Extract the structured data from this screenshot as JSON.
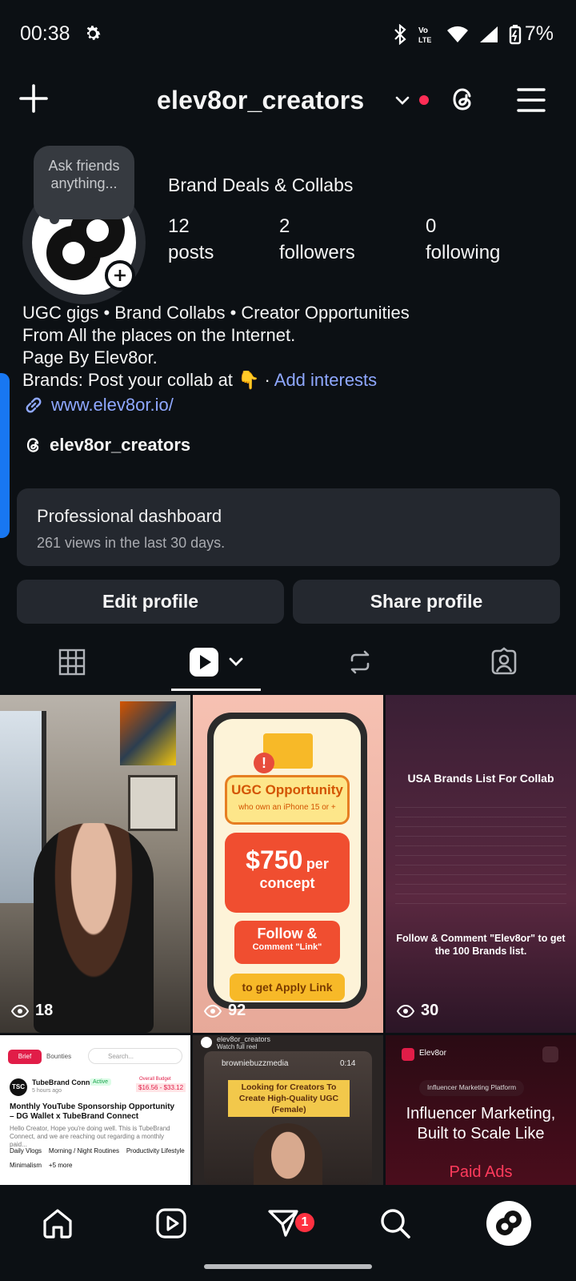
{
  "status": {
    "time": "00:38",
    "battery": "7%"
  },
  "header": {
    "username": "elev8or_creators"
  },
  "profile": {
    "note_bubble": "Ask friends anything...",
    "category": "Brand Deals & Collabs",
    "stats": [
      {
        "value": "12",
        "label": "posts"
      },
      {
        "value": "2",
        "label": "followers"
      },
      {
        "value": "0",
        "label": "following"
      }
    ],
    "bio_lines": [
      "UGC gigs • Brand Collabs • Creator Opportunities",
      "From All the places on the Internet.",
      "Page By Elev8or."
    ],
    "bio_last": "Brands: Post your collab at 👇 · ",
    "add_interests": "Add interests",
    "website": "www.elev8or.io/",
    "threads_handle": "elev8or_creators"
  },
  "dashboard": {
    "title": "Professional dashboard",
    "subtitle": "261 views in the last 30 days."
  },
  "buttons": {
    "edit": "Edit profile",
    "share": "Share profile"
  },
  "posts": [
    {
      "views": "18"
    },
    {
      "views": "92",
      "line1": "UGC Opportunity",
      "line2": "who own an iPhone 15 or +",
      "amount": "$750",
      "per": "per",
      "concept": "concept",
      "follow": "Follow &",
      "comment": "Comment \"Link\"",
      "apply": "to get Apply Link"
    },
    {
      "views": "30",
      "title": "USA Brands List For Collab",
      "cta": "Follow & Comment \"Elev8or\" to get the 100 Brands list."
    },
    {
      "tab1": "Brief",
      "tab2": "Bounties",
      "search": "Search...",
      "company": "TubeBrand Conn...",
      "active": "Active",
      "budget_label": "Overall Budget",
      "budget": "$16.56 - $33.12",
      "time": "5 hours ago",
      "title": "Monthly YouTube Sponsorship Opportunity – DG Wallet x TubeBrand Connect",
      "body": "Hello Creator, Hope you're doing well. This is TubeBrand Connect, and we are reaching out regarding a monthly paid...",
      "tags": "Daily Vlogs    Morning / Night Routines    Productivity Lifestyle",
      "tags2": "Minimalism    +5 more"
    },
    {
      "account": "elev8or_creators",
      "sub": "Watch full reel",
      "source": "browniebuzzmedia",
      "duration": "0:14",
      "caption": "Looking for Creators To Create High-Quality UGC (Female)"
    },
    {
      "brand": "Elev8or",
      "chip": "Influencer Marketing Platform",
      "headline": "Influencer Marketing, Built to Scale Like",
      "headline_red": "Paid Ads"
    }
  ],
  "nav": {
    "badge": "1"
  }
}
